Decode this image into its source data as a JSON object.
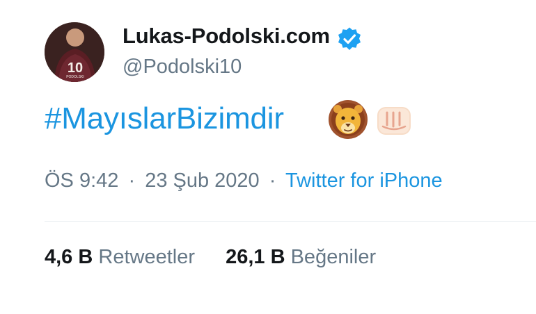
{
  "author": {
    "display_name": "Lukas-Podolski.com",
    "handle": "@Podolski10",
    "verified": true,
    "avatar_jersey_number": "10",
    "avatar_jersey_name": "PODOLSKI"
  },
  "tweet": {
    "text": "#MayıslarBizimdir",
    "emojis": [
      "lion-face-emoji",
      "fist-emoji"
    ],
    "time": "ÖS 9:42",
    "date": "23 Şub 2020",
    "separator": "·",
    "source": "Twitter for iPhone"
  },
  "stats": {
    "retweets_count": "4,6 B",
    "retweets_label": "Retweetler",
    "likes_count": "26,1 B",
    "likes_label": "Beğeniler"
  },
  "colors": {
    "link_blue": "#1b95e0",
    "verified_blue": "#1da1f2",
    "text_primary": "#14171a",
    "text_secondary": "#657786",
    "divider": "#eaeef1"
  }
}
